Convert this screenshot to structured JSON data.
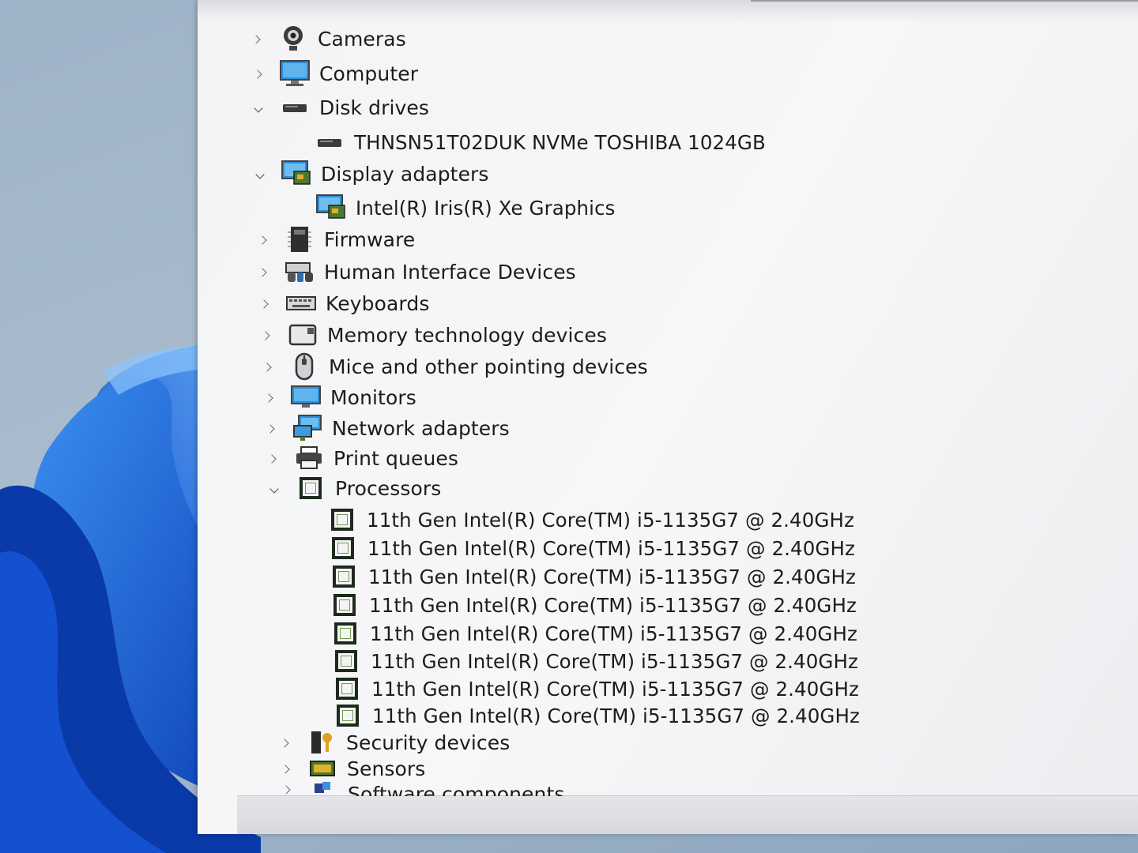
{
  "device_tree": {
    "cameras": {
      "label": "Cameras",
      "icon": "webcam-icon",
      "expanded": false
    },
    "computer": {
      "label": "Computer",
      "icon": "computer-monitor-icon",
      "expanded": false
    },
    "disk_drives": {
      "label": "Disk drives",
      "icon": "disk-drive-icon",
      "expanded": true,
      "children": [
        "THNSN51T02DUK NVMe TOSHIBA 1024GB"
      ]
    },
    "display_adapters": {
      "label": "Display adapters",
      "icon": "display-adapter-icon",
      "expanded": true,
      "children": [
        "Intel(R) Iris(R) Xe Graphics"
      ]
    },
    "firmware": {
      "label": "Firmware",
      "icon": "firmware-chip-icon",
      "expanded": false
    },
    "hid": {
      "label": "Human Interface Devices",
      "icon": "hid-icon",
      "expanded": false
    },
    "keyboards": {
      "label": "Keyboards",
      "icon": "keyboard-icon",
      "expanded": false
    },
    "memory_tech": {
      "label": "Memory technology devices",
      "icon": "memory-card-icon",
      "expanded": false
    },
    "mice": {
      "label": "Mice and other pointing devices",
      "icon": "mouse-icon",
      "expanded": false
    },
    "monitors": {
      "label": "Monitors",
      "icon": "monitor-icon",
      "expanded": false
    },
    "network": {
      "label": "Network adapters",
      "icon": "network-adapter-icon",
      "expanded": false
    },
    "print_queues": {
      "label": "Print queues",
      "icon": "printer-icon",
      "expanded": false
    },
    "processors": {
      "label": "Processors",
      "icon": "processor-icon",
      "expanded": true,
      "children": [
        "11th Gen Intel(R) Core(TM) i5-1135G7 @ 2.40GHz",
        "11th Gen Intel(R) Core(TM) i5-1135G7 @ 2.40GHz",
        "11th Gen Intel(R) Core(TM) i5-1135G7 @ 2.40GHz",
        "11th Gen Intel(R) Core(TM) i5-1135G7 @ 2.40GHz",
        "11th Gen Intel(R) Core(TM) i5-1135G7 @ 2.40GHz",
        "11th Gen Intel(R) Core(TM) i5-1135G7 @ 2.40GHz",
        "11th Gen Intel(R) Core(TM) i5-1135G7 @ 2.40GHz",
        "11th Gen Intel(R) Core(TM) i5-1135G7 @ 2.40GHz"
      ]
    },
    "security": {
      "label": "Security devices",
      "icon": "security-key-icon",
      "expanded": false
    },
    "sensors": {
      "label": "Sensors",
      "icon": "sensor-icon",
      "expanded": false
    },
    "software_components": {
      "label": "Software components",
      "icon": "software-component-icon",
      "expanded": false
    }
  },
  "colors": {
    "wallpaper_blue": "#1f5fd6",
    "window_bg": "#f4f5f7",
    "text": "#1c1c1c",
    "cpu_green": "#6f9a4f"
  }
}
